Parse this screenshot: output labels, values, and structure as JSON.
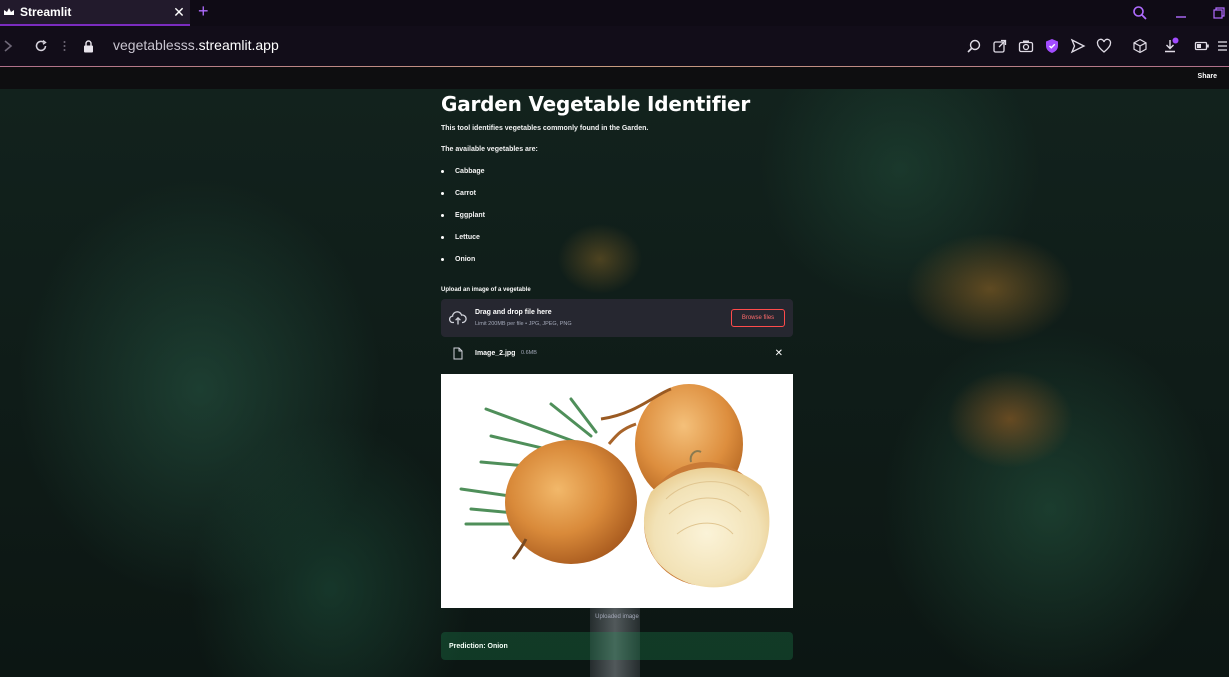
{
  "browser": {
    "tab_title": "Streamlit",
    "url_prefix": "vegetablesss.",
    "url_domain": "streamlit.app",
    "accent_color": "#b06cff"
  },
  "header": {
    "share_label": "Share"
  },
  "app": {
    "title": "Garden Vegetable Identifier",
    "intro": "This tool identifies vegetables commonly found in the Garden.",
    "available_heading": "The available vegetables are:",
    "vegetables": [
      "Cabbage",
      "Carrot",
      "Eggplant",
      "Lettuce",
      "Onion"
    ],
    "upload_label": "Upload an image of a vegetable",
    "dropzone": {
      "title": "Drag and drop file here",
      "limit": "Limit 200MB per file • JPG, JPEG, PNG",
      "browse_label": "Browse files"
    },
    "file": {
      "name": "Image_2.jpg",
      "size": "0.6MB"
    },
    "image_caption": "Uploaded image",
    "prediction": "Prediction: Onion"
  }
}
